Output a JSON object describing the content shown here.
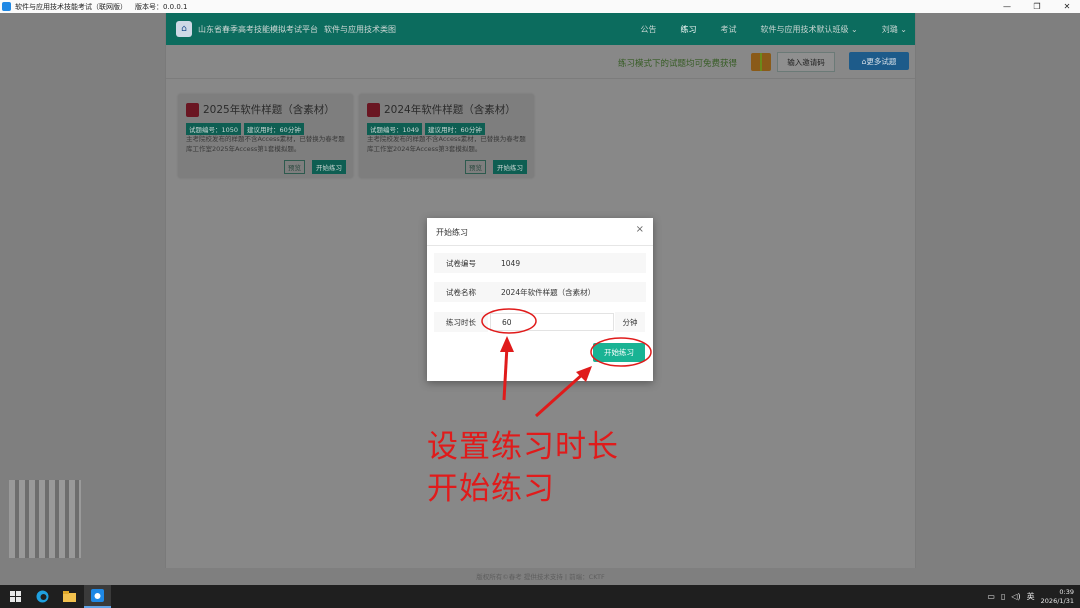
{
  "window": {
    "title": "软件与应用技术技能考试（联网版）",
    "version_label": "版本号：0.0.0.1",
    "controls": [
      "—",
      "❐",
      "✕"
    ]
  },
  "nav": {
    "logo_glyph": "⌂",
    "title": "山东省春季高考技能模拟考试平台",
    "subtitle": "软件与应用技术类图",
    "items": [
      "公告",
      "练习",
      "考试",
      "软件与应用技术默认班级 ⌄",
      "刘璐 ⌄"
    ],
    "active_index": 1
  },
  "toolbar": {
    "free_text": "练习模式下的试题均可免费获得",
    "code_button": "输入邀请码",
    "more_button": "⌂更多试题"
  },
  "cards": [
    {
      "title": "2025年软件样题（含素材）",
      "tag_id": "试题编号：1050",
      "tag_time": "建议用时：60分钟",
      "desc": "主考院校发布的样题不含Access素材，已替换为春考题库工作室2025年Access第1套模拟题。",
      "preview": "预览",
      "practice": "开始练习"
    },
    {
      "title": "2024年软件样题（含素材）",
      "tag_id": "试题编号：1049",
      "tag_time": "建议用时：60分钟",
      "desc": "主考院校发布的样题不含Access素材，已替换为春考题库工作室2024年Access第3套模拟题。",
      "preview": "预览",
      "practice": "开始练习"
    }
  ],
  "footer": "版权所有©春考 提供技术支持 | 前端：CKTF",
  "dialog": {
    "title": "开始练习",
    "close": "×",
    "paper_id_label": "试卷编号",
    "paper_id": "1049",
    "paper_name_label": "试卷名称",
    "paper_name": "2024年软件样题（含素材）",
    "duration_label": "练习时长",
    "duration": "60",
    "duration_unit": "分钟",
    "start_button": "开始练习"
  },
  "annotation": {
    "line1": "设置练习时长",
    "line2": "开始练习",
    "color": "#e01b1b"
  },
  "taskbar": {
    "tray_text": "英",
    "time": "0:39",
    "date": "2026/1/31"
  }
}
